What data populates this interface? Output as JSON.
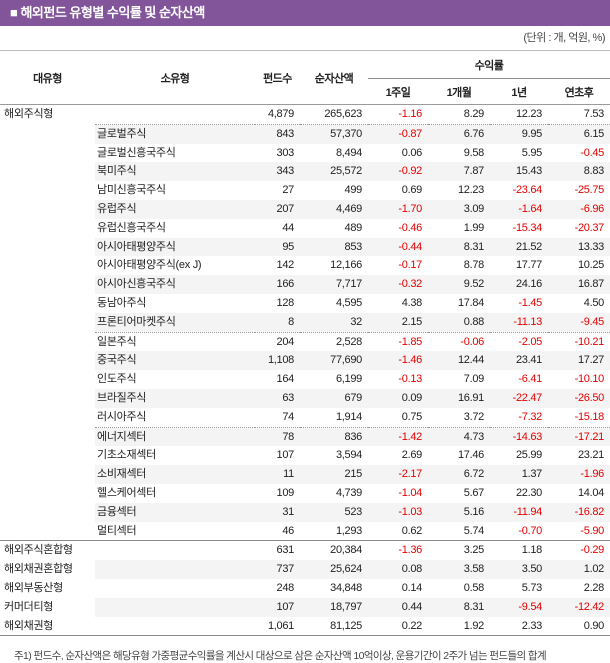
{
  "title": "■ 해외펀드 유형별 수익률 및 순자산액",
  "units_note": "(단위 : 개, 억원, %)",
  "colors": {
    "title_bg": "#82559B",
    "title_text": "#ffffff",
    "negative_value": "#e60000",
    "row_shade": "#f4f4f4"
  },
  "table": {
    "columns": [
      "대유형",
      "소유형",
      "펀드수",
      "순자산액"
    ],
    "returns_group_label": "수익률",
    "return_columns": [
      "1주일",
      "1개월",
      "1년",
      "연초후"
    ],
    "rows": [
      {
        "major": "해외주식형",
        "minor": "",
        "funds": "4,879",
        "nav": "265,623",
        "w1": "-1.16",
        "m1": "8.29",
        "y1": "12.23",
        "ytd": "7.53",
        "sep": "dotted"
      },
      {
        "major": "",
        "minor": "글로벌주식",
        "funds": "843",
        "nav": "57,370",
        "w1": "-0.87",
        "m1": "6.76",
        "y1": "9.95",
        "ytd": "6.15",
        "sep": ""
      },
      {
        "major": "",
        "minor": "글로벌신흥국주식",
        "funds": "303",
        "nav": "8,494",
        "w1": "0.06",
        "m1": "9.58",
        "y1": "5.95",
        "ytd": "-0.45",
        "sep": ""
      },
      {
        "major": "",
        "minor": "북미주식",
        "funds": "343",
        "nav": "25,572",
        "w1": "-0.92",
        "m1": "7.87",
        "y1": "15.43",
        "ytd": "8.83",
        "sep": ""
      },
      {
        "major": "",
        "minor": "남미신흥국주식",
        "funds": "27",
        "nav": "499",
        "w1": "0.69",
        "m1": "12.23",
        "y1": "-23.64",
        "ytd": "-25.75",
        "sep": ""
      },
      {
        "major": "",
        "minor": "유럽주식",
        "funds": "207",
        "nav": "4,469",
        "w1": "-1.70",
        "m1": "3.09",
        "y1": "-1.64",
        "ytd": "-6.96",
        "sep": ""
      },
      {
        "major": "",
        "minor": "유럽신흥국주식",
        "funds": "44",
        "nav": "489",
        "w1": "-0.46",
        "m1": "1.99",
        "y1": "-15.34",
        "ytd": "-20.37",
        "sep": ""
      },
      {
        "major": "",
        "minor": "아시아태평양주식",
        "funds": "95",
        "nav": "853",
        "w1": "-0.44",
        "m1": "8.31",
        "y1": "21.52",
        "ytd": "13.33",
        "sep": ""
      },
      {
        "major": "",
        "minor": "아시아태평양주식(ex J)",
        "funds": "142",
        "nav": "12,166",
        "w1": "-0.17",
        "m1": "8.78",
        "y1": "17.77",
        "ytd": "10.25",
        "sep": ""
      },
      {
        "major": "",
        "minor": "아시아신흥국주식",
        "funds": "166",
        "nav": "7,717",
        "w1": "-0.32",
        "m1": "9.52",
        "y1": "24.16",
        "ytd": "16.87",
        "sep": ""
      },
      {
        "major": "",
        "minor": "동남아주식",
        "funds": "128",
        "nav": "4,595",
        "w1": "4.38",
        "m1": "17.84",
        "y1": "-1.45",
        "ytd": "4.50",
        "sep": ""
      },
      {
        "major": "",
        "minor": "프론티어마켓주식",
        "funds": "8",
        "nav": "32",
        "w1": "2.15",
        "m1": "0.88",
        "y1": "-11.13",
        "ytd": "-9.45",
        "sep": "dotted"
      },
      {
        "major": "",
        "minor": "일본주식",
        "funds": "204",
        "nav": "2,528",
        "w1": "-1.85",
        "m1": "-0.06",
        "y1": "-2.05",
        "ytd": "-10.21",
        "sep": ""
      },
      {
        "major": "",
        "minor": "중국주식",
        "funds": "1,108",
        "nav": "77,690",
        "w1": "-1.46",
        "m1": "12.44",
        "y1": "23.41",
        "ytd": "17.27",
        "sep": ""
      },
      {
        "major": "",
        "minor": "인도주식",
        "funds": "164",
        "nav": "6,199",
        "w1": "-0.13",
        "m1": "7.09",
        "y1": "-6.41",
        "ytd": "-10.10",
        "sep": ""
      },
      {
        "major": "",
        "minor": "브라질주식",
        "funds": "63",
        "nav": "679",
        "w1": "0.09",
        "m1": "16.91",
        "y1": "-22.47",
        "ytd": "-26.50",
        "sep": ""
      },
      {
        "major": "",
        "minor": "러시아주식",
        "funds": "74",
        "nav": "1,914",
        "w1": "0.75",
        "m1": "3.72",
        "y1": "-7.32",
        "ytd": "-15.18",
        "sep": "dotted"
      },
      {
        "major": "",
        "minor": "에너지섹터",
        "funds": "78",
        "nav": "836",
        "w1": "-1.42",
        "m1": "4.73",
        "y1": "-14.63",
        "ytd": "-17.21",
        "sep": ""
      },
      {
        "major": "",
        "minor": "기초소재섹터",
        "funds": "107",
        "nav": "3,594",
        "w1": "2.69",
        "m1": "17.46",
        "y1": "25.99",
        "ytd": "23.21",
        "sep": ""
      },
      {
        "major": "",
        "minor": "소비재섹터",
        "funds": "11",
        "nav": "215",
        "w1": "-2.17",
        "m1": "6.72",
        "y1": "1.37",
        "ytd": "-1.96",
        "sep": ""
      },
      {
        "major": "",
        "minor": "헬스케어섹터",
        "funds": "109",
        "nav": "4,739",
        "w1": "-1.04",
        "m1": "5.67",
        "y1": "22.30",
        "ytd": "14.04",
        "sep": ""
      },
      {
        "major": "",
        "minor": "금융섹터",
        "funds": "31",
        "nav": "523",
        "w1": "-1.03",
        "m1": "5.16",
        "y1": "-11.94",
        "ytd": "-16.82",
        "sep": ""
      },
      {
        "major": "",
        "minor": "멀티섹터",
        "funds": "46",
        "nav": "1,293",
        "w1": "0.62",
        "m1": "5.74",
        "y1": "-0.70",
        "ytd": "-5.90",
        "sep": "solid"
      },
      {
        "major": "해외주식혼합형",
        "minor": "",
        "funds": "631",
        "nav": "20,384",
        "w1": "-1.36",
        "m1": "3.25",
        "y1": "1.18",
        "ytd": "-0.29",
        "sep": ""
      },
      {
        "major": "해외채권혼합형",
        "minor": "",
        "funds": "737",
        "nav": "25,624",
        "w1": "0.08",
        "m1": "3.58",
        "y1": "3.50",
        "ytd": "1.02",
        "sep": ""
      },
      {
        "major": "해외부동산형",
        "minor": "",
        "funds": "248",
        "nav": "34,848",
        "w1": "0.14",
        "m1": "0.58",
        "y1": "5.73",
        "ytd": "2.28",
        "sep": ""
      },
      {
        "major": "커머더티형",
        "minor": "",
        "funds": "107",
        "nav": "18,797",
        "w1": "0.44",
        "m1": "8.31",
        "y1": "-9.54",
        "ytd": "-12.42",
        "sep": ""
      },
      {
        "major": "해외채권형",
        "minor": "",
        "funds": "1,061",
        "nav": "81,125",
        "w1": "0.22",
        "m1": "1.92",
        "y1": "2.33",
        "ytd": "0.90",
        "sep": ""
      }
    ]
  },
  "footnote": "주1) 펀드수, 순자산액은 해당유형 가중평균수익률을 계산시 대상으로 삼은 순자산액 10억이상, 운용기간이 2주가 넘는 펀드들의 합계"
}
